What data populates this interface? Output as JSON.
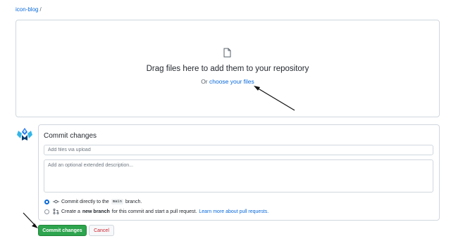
{
  "breadcrumb": {
    "repo": "icon-blog",
    "separator": "/"
  },
  "upload": {
    "title": "Drag files here to add them to your repository",
    "or_text": "Or ",
    "choose_link": "choose your files"
  },
  "commit": {
    "heading": "Commit changes",
    "summary_placeholder": "Add files via upload",
    "description_placeholder": "Add an optional extended description...",
    "option_direct": {
      "prefix": "Commit directly to the",
      "branch": "main",
      "suffix": "branch.",
      "selected": true
    },
    "option_new": {
      "prefix": "Create a",
      "bold": "new branch",
      "middle": "for this commit and start a pull request.",
      "link": "Learn more about pull requests.",
      "selected": false
    },
    "commit_button": "Commit changes",
    "cancel_button": "Cancel"
  },
  "icons": [
    "file-icon",
    "avatar-icon",
    "git-commit-icon",
    "git-pull-request-icon"
  ],
  "colors": {
    "link": "#0969da",
    "commit_button": "#2da44e",
    "cancel_text": "#cf222e",
    "border": "#d0d7de"
  }
}
